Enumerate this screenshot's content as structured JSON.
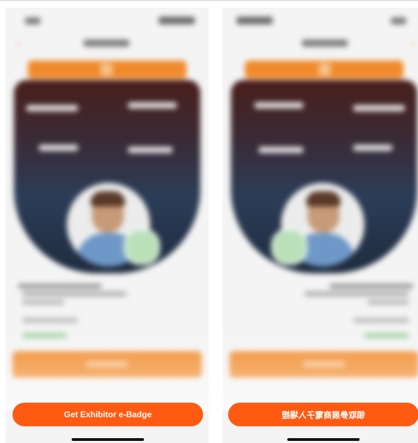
{
  "panels": {
    "left": {
      "cta_label": "Get Exhibitor e-Badge"
    },
    "right": {
      "cta_label": "領取參展商電子入場證"
    }
  },
  "colors": {
    "accent_orange": "#f08a2b",
    "cta_orange": "#ff5a12",
    "badge_dark_red": "#4a1f1b",
    "badge_navy": "#2b3d57",
    "check_green": "#b9e0b9"
  },
  "icons": {
    "back": "chevron-left-icon",
    "check": "check-icon"
  }
}
